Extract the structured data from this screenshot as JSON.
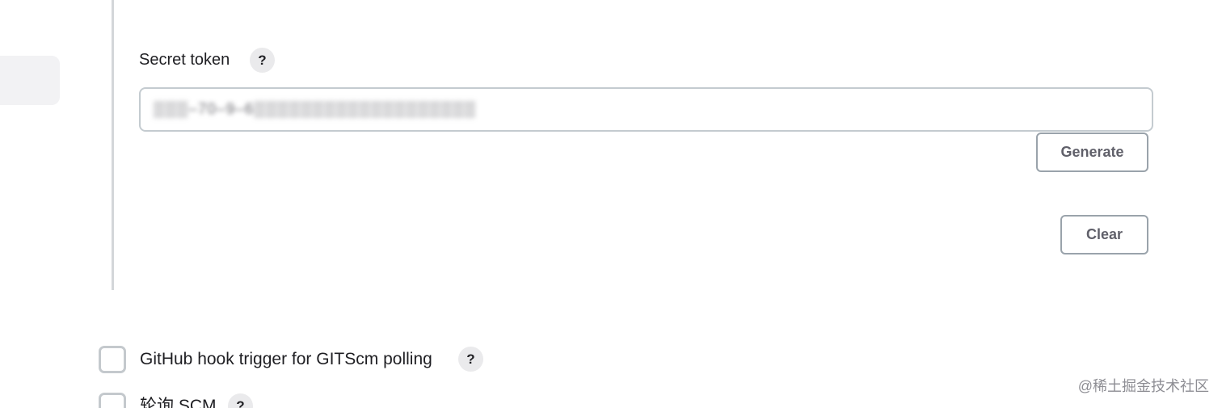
{
  "secret_token": {
    "label": "Secret token",
    "help_icon": "?",
    "value": "▒▒▒‒70‒9‒6▒▒▒▒▒▒▒▒▒▒▒▒▒▒▒▒▒▒▒",
    "generate_label": "Generate",
    "clear_label": "Clear"
  },
  "triggers": [
    {
      "label": "GitHub hook trigger for GITScm polling",
      "help_icon": "?",
      "checked": false
    },
    {
      "label": "轮询 SCM",
      "help_icon": "?",
      "checked": false
    }
  ],
  "watermark": "@稀土掘金技术社区",
  "colors": {
    "border": "#c4cbd0",
    "button_border": "#9aa3ab",
    "help_bg": "#eaeaec",
    "text": "#1f1f23"
  }
}
